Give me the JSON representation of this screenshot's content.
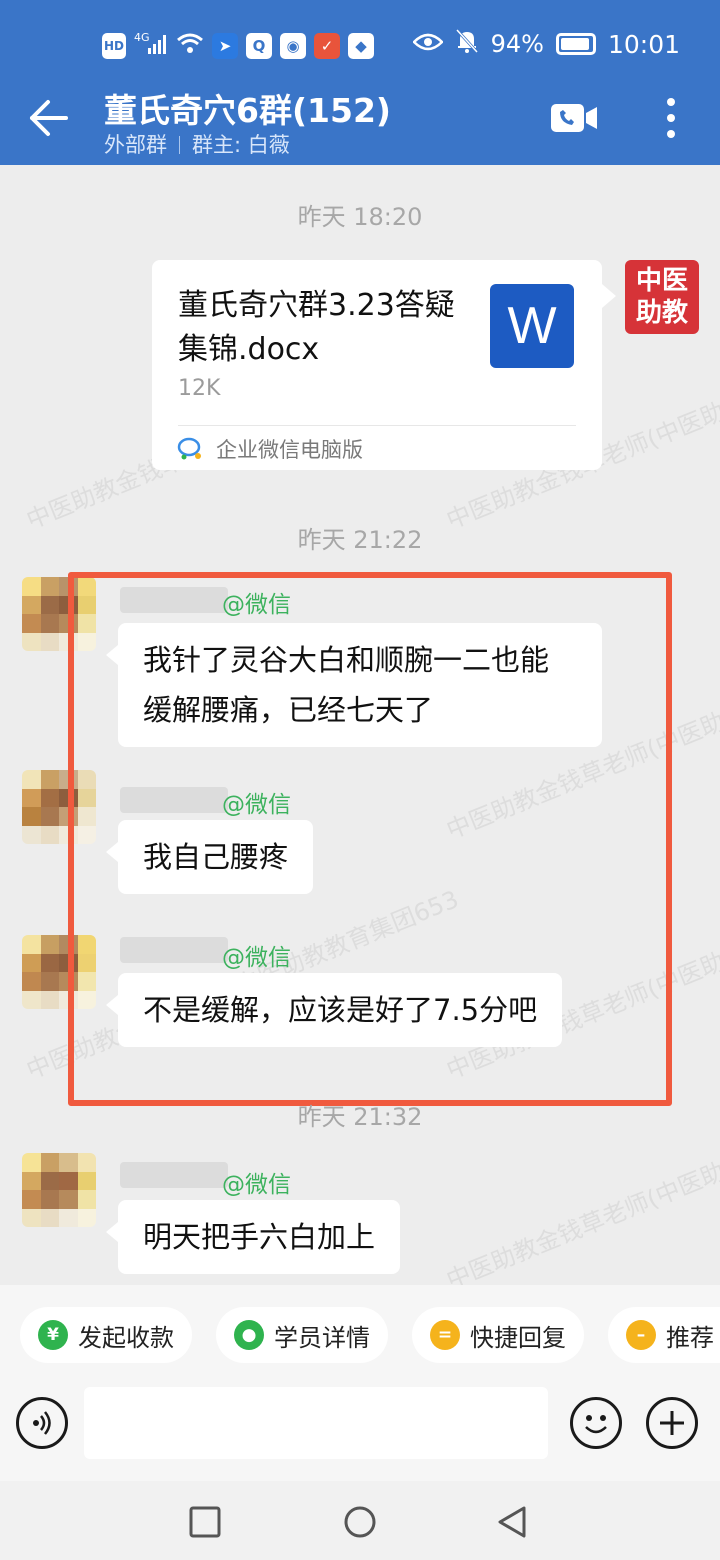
{
  "status_bar": {
    "time": "10:01",
    "battery": "94%",
    "signal": "4G",
    "hd": "HD"
  },
  "header": {
    "title": "董氏奇穴6群(152)",
    "group_type": "外部群",
    "group_owner": "群主: 白薇"
  },
  "chat": {
    "watermark": "中医助教金钱草老师(中医助教教育集团653",
    "messages": [
      {
        "type": "time",
        "text": "昨天  18:20"
      },
      {
        "type": "file",
        "file_name": "董氏奇穴群3.23答疑集锦.docx",
        "file_size": "12K",
        "file_source": "企业微信电脑版",
        "file_icon_letter": "W",
        "sender_avatar_text": "中医助教"
      },
      {
        "type": "time",
        "text": "昨天  21:22"
      },
      {
        "type": "text",
        "source": "@微信",
        "text": "我针了灵谷大白和顺腕一二也能缓解腰痛，已经七天了"
      },
      {
        "type": "text",
        "source": "@微信",
        "text": "我自己腰疼"
      },
      {
        "type": "text",
        "source": "@微信",
        "text": "不是缓解，应该是好了7.5分吧"
      },
      {
        "type": "time",
        "text": "昨天  21:32"
      },
      {
        "type": "text",
        "source": "@微信",
        "text": "明天把手六白加上"
      }
    ]
  },
  "quick_actions": [
    {
      "label": "发起收款",
      "icon": "yuan-icon",
      "color": "#2fb34e"
    },
    {
      "label": "学员详情",
      "icon": "person-icon",
      "color": "#2fb34e"
    },
    {
      "label": "快捷回复",
      "icon": "reply-icon",
      "color": "#f5b31c"
    },
    {
      "label": "推荐",
      "icon": "recommend-icon",
      "color": "#f5b31c"
    }
  ],
  "colors": {
    "header": "#3a75c8",
    "highlight_box": "#f05a3e",
    "wechat_source": "#3db25e"
  }
}
